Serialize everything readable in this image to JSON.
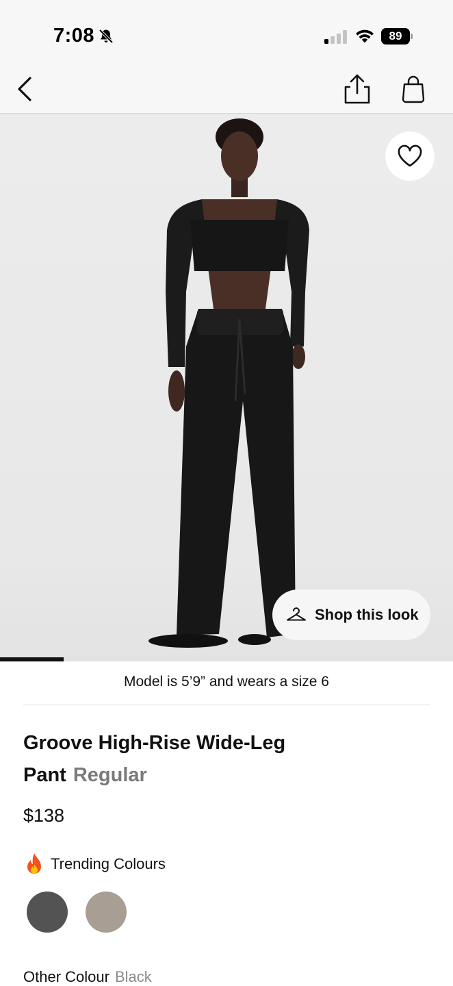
{
  "status_bar": {
    "time": "7:08",
    "battery": "89"
  },
  "nav": {
    "back_icon": "chevron-left-icon",
    "share_icon": "share-icon",
    "bag_icon": "shopping-bag-icon"
  },
  "hero": {
    "wishlist_icon": "heart-icon",
    "shop_look_label": "Shop this look",
    "shop_look_icon": "hanger-icon",
    "carousel_progress": 0.14
  },
  "product": {
    "model_note": "Model is 5’9” and wears a size 6",
    "title": "Groove High-Rise Wide-Leg Pant",
    "fit": "Regular",
    "price": "$138",
    "trending_label": "Trending Colours",
    "trending_icon": "fire-icon",
    "swatches": [
      {
        "name": "dark grey",
        "color": "#535353"
      },
      {
        "name": "taupe",
        "color": "#a89e93"
      }
    ],
    "other_colour_label": "Other Colour",
    "other_colour_value": "Black"
  }
}
